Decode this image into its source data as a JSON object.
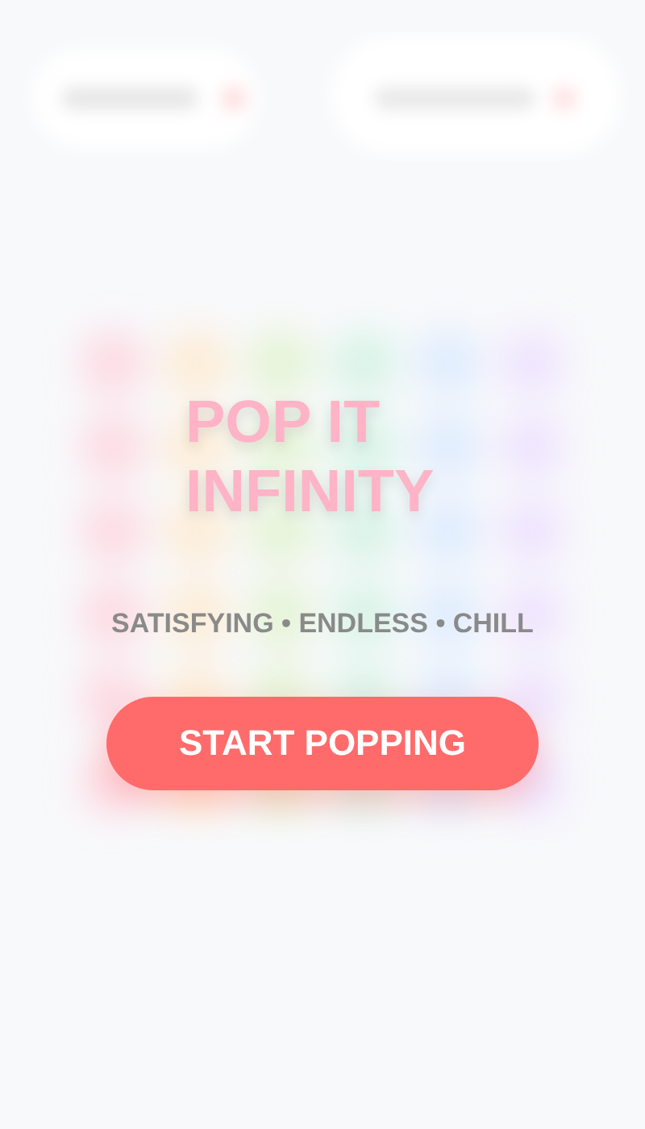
{
  "title": "POP IT INFINITY",
  "tagline": "SATISFYING • ENDLESS • CHILL",
  "start_button": {
    "label": "START POPPING"
  }
}
